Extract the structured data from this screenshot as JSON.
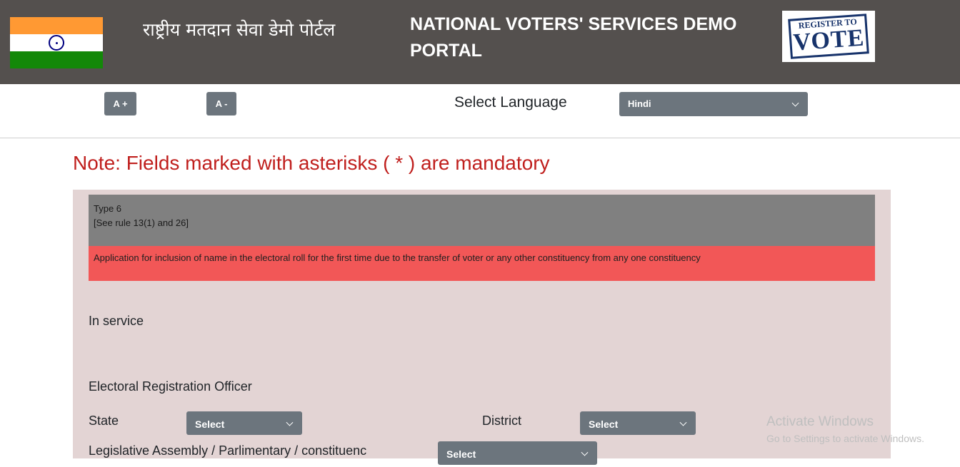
{
  "header": {
    "hindi_title": "राष्ट्रीय मतदान सेवा डेमो पोर्टल",
    "english_title": "NATIONAL VOTERS' SERVICES DEMO PORTAL",
    "logo": {
      "line1": "REGISTER TO",
      "line2": "VOTE"
    }
  },
  "toolbar": {
    "font_increase": "A +",
    "font_decrease": "A -",
    "language_label": "Select Language",
    "language_value": "Hindi"
  },
  "note": "Note: Fields marked with asterisks ( * ) are mandatory",
  "form": {
    "type_line1": "Type 6",
    "type_line2": "[See rule 13(1) and 26]",
    "application_text": "Application for inclusion of name in the electoral roll for the first time due to the transfer of voter or any other constituency from any one constituency",
    "in_service_label": "In service",
    "ero_label": "Electoral Registration Officer",
    "state_label": "State",
    "state_value": "Select",
    "district_label": "District",
    "district_value": "Select",
    "assembly_label": "Legislative Assembly / Parlimentary / constituenc",
    "assembly_value": "Select"
  },
  "watermark": {
    "title": "Activate Windows",
    "subtitle": "Go to Settings to activate Windows."
  },
  "colors": {
    "header_bg": "#54504e",
    "note_red": "#c0201e",
    "panel_bg": "#e3d4d4",
    "type_box": "#808080",
    "application_box": "#f25757",
    "button_gray": "#6c757d"
  }
}
